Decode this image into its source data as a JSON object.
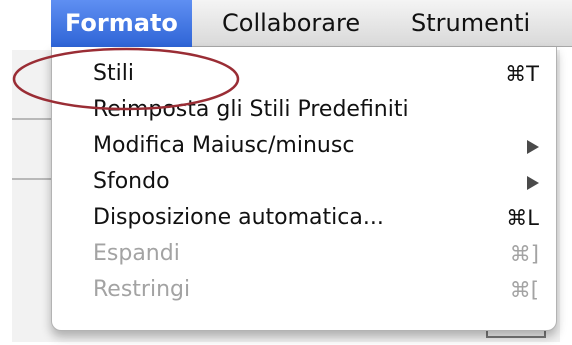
{
  "menubar": {
    "items": [
      {
        "label": "Formato",
        "active": true
      },
      {
        "label": "Collaborare",
        "active": false
      },
      {
        "label": "Strumenti",
        "active": false
      }
    ]
  },
  "dropdown": {
    "items": [
      {
        "label": "Stili",
        "shortcut": "⌘T",
        "submenu": false,
        "enabled": true
      },
      {
        "label": "Reimposta gli Stili Predefiniti",
        "shortcut": "",
        "submenu": false,
        "enabled": true
      },
      {
        "label": "Modifica Maiusc/minusc",
        "shortcut": "",
        "submenu": true,
        "enabled": true
      },
      {
        "label": "Sfondo",
        "shortcut": "",
        "submenu": true,
        "enabled": true
      },
      {
        "label": "Disposizione automatica...",
        "shortcut": "⌘L",
        "submenu": false,
        "enabled": true
      },
      {
        "label": "Espandi",
        "shortcut": "⌘]",
        "submenu": false,
        "enabled": false
      },
      {
        "label": "Restringi",
        "shortcut": "⌘[",
        "submenu": false,
        "enabled": false
      }
    ]
  },
  "annotation": {
    "shape": "ellipse",
    "color": "#9a2d35",
    "target": "Stili"
  },
  "colors": {
    "highlight": "#3b6fe0",
    "disabled_text": "#a3a3a3"
  }
}
